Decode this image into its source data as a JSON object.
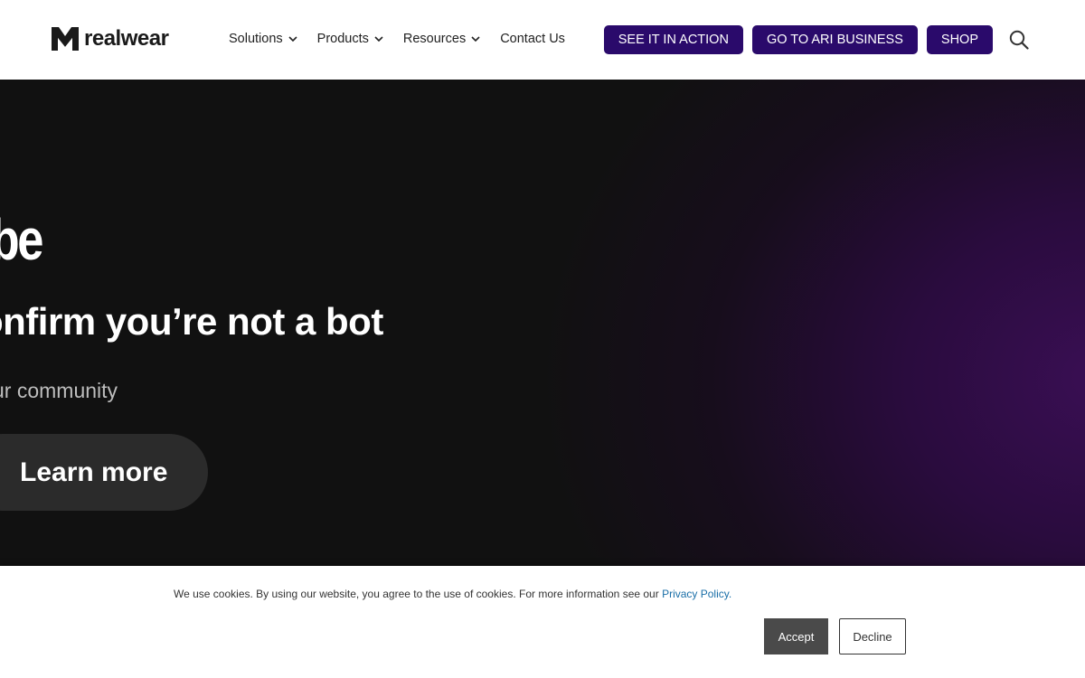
{
  "header": {
    "logo_text": "realwear",
    "logo_mark": "",
    "nav": [
      {
        "label": "Solutions",
        "icon": "chevron-down-icon"
      },
      {
        "label": "Products",
        "icon": "chevron-down-icon"
      },
      {
        "label": "Resources",
        "icon": "chevron-down-icon"
      },
      {
        "label": "Contact Us"
      }
    ],
    "cta": {
      "see_it": "SEE IT IN ACTION",
      "ari": "GO TO ARI BUSINESS",
      "shop": "SHOP"
    },
    "search_icon": "search-icon",
    "accent_color": "#2a0a6b"
  },
  "hero": {
    "title_fragment": "ube",
    "subtitle_fragment": "onfirm you’re not a bot",
    "text_fragment": "ur community",
    "button_label": "Learn more",
    "gradient_color": "#3a0e54"
  },
  "cookie": {
    "text": "We use cookies. By using our website, you agree to the use of cookies. For more information see our ",
    "link": "Privacy Policy",
    "link_suffix": ".",
    "accept": "Accept",
    "decline": "Decline"
  }
}
